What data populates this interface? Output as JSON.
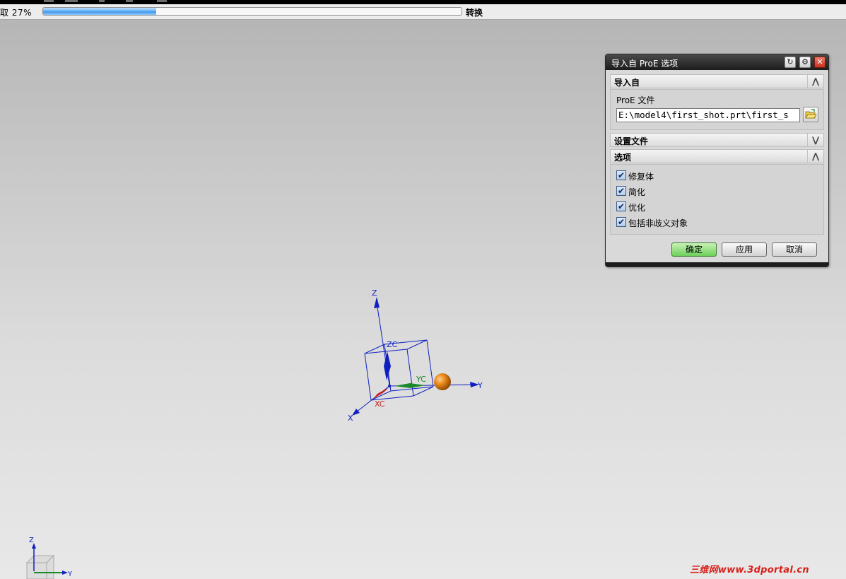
{
  "progress": {
    "label": "取 27%",
    "percent": 27,
    "status": "转换"
  },
  "dialog": {
    "title": "导入自 ProE 选项",
    "sections": {
      "import_from": {
        "header": "导入自",
        "file_label": "ProE 文件",
        "file_value": "E:\\model4\\first_shot.prt\\first_s"
      },
      "settings_file": {
        "header": "设置文件"
      },
      "options": {
        "header": "选项",
        "items": [
          {
            "label": "修复体",
            "checked": true
          },
          {
            "label": "简化",
            "checked": true
          },
          {
            "label": "优化",
            "checked": true
          },
          {
            "label": "包括非歧义对象",
            "checked": true
          }
        ]
      }
    },
    "buttons": {
      "ok": "确定",
      "apply": "应用",
      "cancel": "取消"
    }
  },
  "triad": {
    "z": "Z",
    "zc": "ZC",
    "y": "Y",
    "yc": "YC",
    "x": "X",
    "xc": "XC"
  },
  "mini_triad": {
    "z": "Z",
    "y": "Y"
  },
  "watermark": "三维网www.3dportal.cn",
  "colors": {
    "z_axis": "#1020c0",
    "y_axis": "#1a8a2a",
    "x_axis": "#c02020",
    "ok_button": "#6cd05a",
    "sphere": "#e07b10"
  }
}
